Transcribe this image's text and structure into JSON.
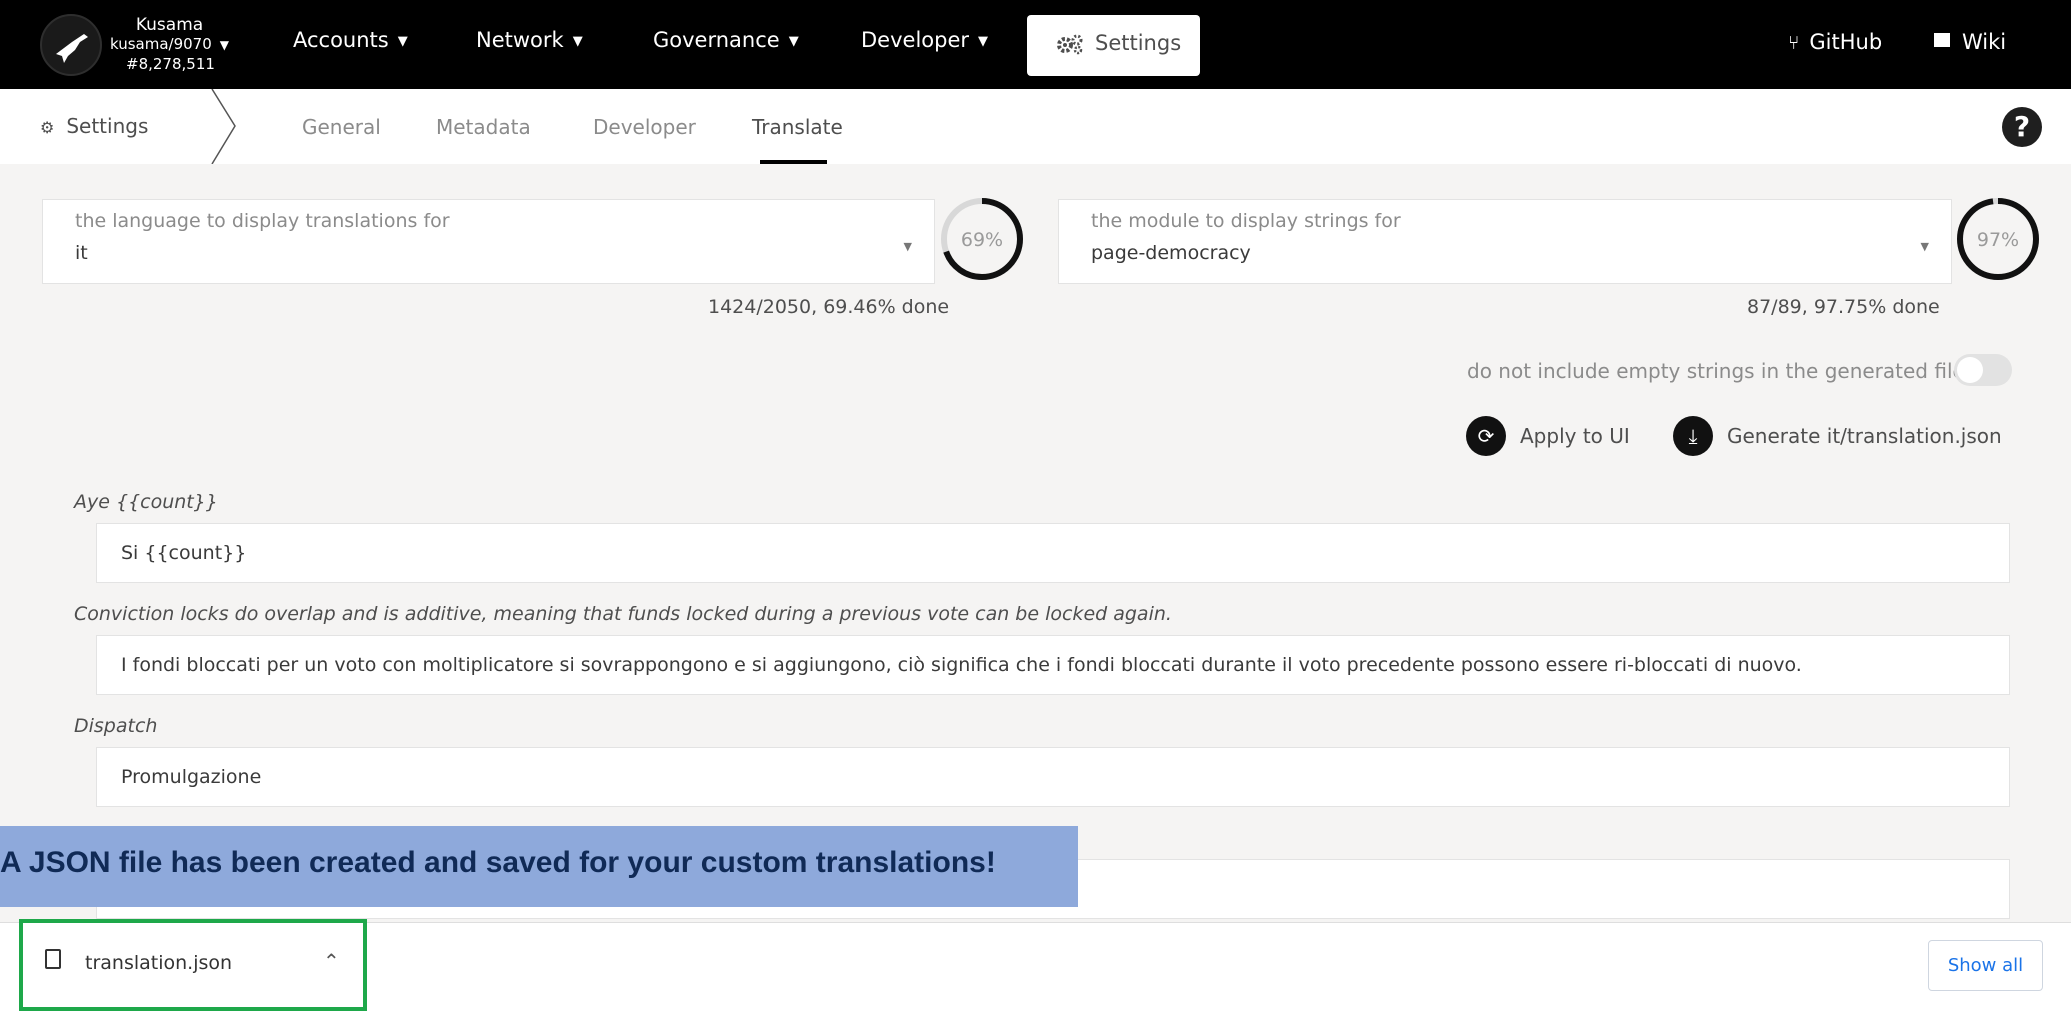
{
  "topnav": {
    "chain": {
      "name": "Kusama",
      "runtime": "kusama/9070",
      "block": "#8,278,511"
    },
    "items": [
      {
        "label": "Accounts"
      },
      {
        "label": "Network"
      },
      {
        "label": "Governance"
      },
      {
        "label": "Developer"
      }
    ],
    "settings_label": "Settings",
    "github_label": "GitHub",
    "wiki_label": "Wiki"
  },
  "subnav": {
    "section_label": "Settings",
    "tabs": [
      {
        "label": "General"
      },
      {
        "label": "Metadata"
      },
      {
        "label": "Developer"
      },
      {
        "label": "Translate",
        "active": true
      }
    ]
  },
  "language": {
    "label": "the language to display translations for",
    "value": "it",
    "percent_label": "69%",
    "percent": 69.46,
    "progress_text": "1424/2050, 69.46% done"
  },
  "module": {
    "label": "the module to display strings for",
    "value": "page-democracy",
    "percent_label": "97%",
    "percent": 97.75,
    "progress_text": "87/89, 97.75% done"
  },
  "toggle": {
    "label": "do not include empty strings in the generated file",
    "on": false
  },
  "actions": {
    "apply_label": "Apply to UI",
    "generate_label": "Generate it/translation.json"
  },
  "translations": [
    {
      "key": "Aye {{count}}",
      "value": "Si {{count}}"
    },
    {
      "key": "Conviction locks do overlap and is additive, meaning that funds locked during a previous vote can be locked again.",
      "value": "I fondi bloccati per un voto con moltiplicatore si sovrappongono e si aggiungono, ciò significa che i fondi bloccati durante il voto precedente possono essere ri-bloccati di nuovo."
    },
    {
      "key": "Dispatch",
      "value": "Promulgazione"
    },
    {
      "key": "",
      "value": ""
    }
  ],
  "banner": {
    "text": "A JSON file has been created and saved for your custom translations!"
  },
  "download": {
    "file_name": "translation.json",
    "show_all_label": "Show all"
  },
  "icons": {
    "logo": "kusama-bird-icon",
    "settings": "gears-icon",
    "github": "git-branch-icon",
    "wiki": "book-icon",
    "help": "question-circle-icon",
    "apply": "sync-icon",
    "generate": "download-icon",
    "file": "file-icon"
  },
  "colors": {
    "nav_bg": "#000000",
    "banner_bg": "#8ea9db",
    "highlight_box": "#1ea84a",
    "link": "#1a73e8"
  }
}
